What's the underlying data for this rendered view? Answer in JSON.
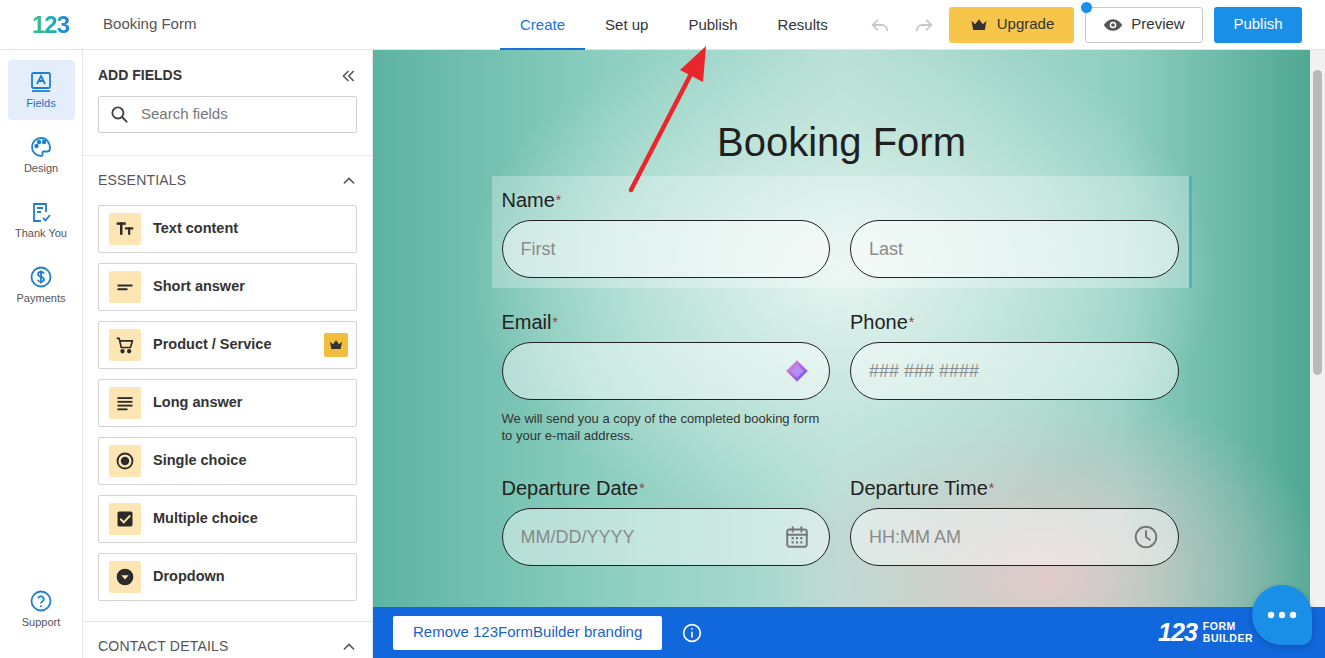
{
  "header": {
    "logo": "123",
    "title": "Booking Form"
  },
  "tabs": [
    {
      "label": "Create",
      "selected": true
    },
    {
      "label": "Set up",
      "selected": false
    },
    {
      "label": "Publish",
      "selected": false
    },
    {
      "label": "Results",
      "selected": false
    }
  ],
  "history": {
    "undo_disabled": true,
    "redo_disabled": true
  },
  "actions": {
    "upgrade": "Upgrade",
    "preview": "Preview",
    "preview_notification": true,
    "publish": "Publish"
  },
  "rail": {
    "items": [
      {
        "label": "Fields",
        "selected": true
      },
      {
        "label": "Design",
        "selected": false
      },
      {
        "label": "Thank You",
        "selected": false
      },
      {
        "label": "Payments",
        "selected": false
      }
    ],
    "support": "Support"
  },
  "panel": {
    "title": "ADD FIELDS",
    "search": {
      "placeholder": "Search fields"
    },
    "sections": [
      {
        "title": "ESSENTIALS",
        "expanded": true,
        "fields": [
          {
            "label": "Text content",
            "premium": false
          },
          {
            "label": "Short answer",
            "premium": false
          },
          {
            "label": "Product / Service",
            "premium": true
          },
          {
            "label": "Long answer",
            "premium": false
          },
          {
            "label": "Single choice",
            "premium": false
          },
          {
            "label": "Multiple choice",
            "premium": false
          },
          {
            "label": "Dropdown",
            "premium": false
          }
        ]
      },
      {
        "title": "CONTACT DETAILS",
        "expanded": true,
        "fields": []
      }
    ]
  },
  "form": {
    "title": "Booking Form",
    "required_mark": "*",
    "rows": [
      {
        "selected": true,
        "fields": [
          {
            "label": "Name",
            "required": true,
            "kind": "text",
            "inputs": [
              {
                "placeholder": "First"
              },
              {
                "placeholder": "Last"
              }
            ]
          }
        ]
      },
      {
        "selected": false,
        "fields": [
          {
            "label": "Email",
            "required": true,
            "kind": "email",
            "inputs": [
              {}
            ],
            "help": "We will send you a copy of the completed booking form to your e-mail address."
          },
          {
            "label": "Phone",
            "required": true,
            "kind": "phone",
            "inputs": [
              {
                "placeholder": "### ### ####"
              }
            ]
          }
        ]
      },
      {
        "selected": false,
        "fields": [
          {
            "label": "Departure Date",
            "required": true,
            "kind": "date",
            "inputs": [
              {
                "placeholder": "MM/DD/YYYY"
              }
            ]
          },
          {
            "label": "Departure Time",
            "required": true,
            "kind": "time",
            "inputs": [
              {
                "placeholder": "HH:MM AM"
              }
            ]
          }
        ]
      }
    ]
  },
  "canvas": {
    "scrollbar": {
      "level": 0.58
    }
  },
  "branding": {
    "button": "Remove 123FormBuilder branding",
    "logo_number": "123",
    "logo_words": [
      "FORM",
      "BUILDER"
    ]
  }
}
